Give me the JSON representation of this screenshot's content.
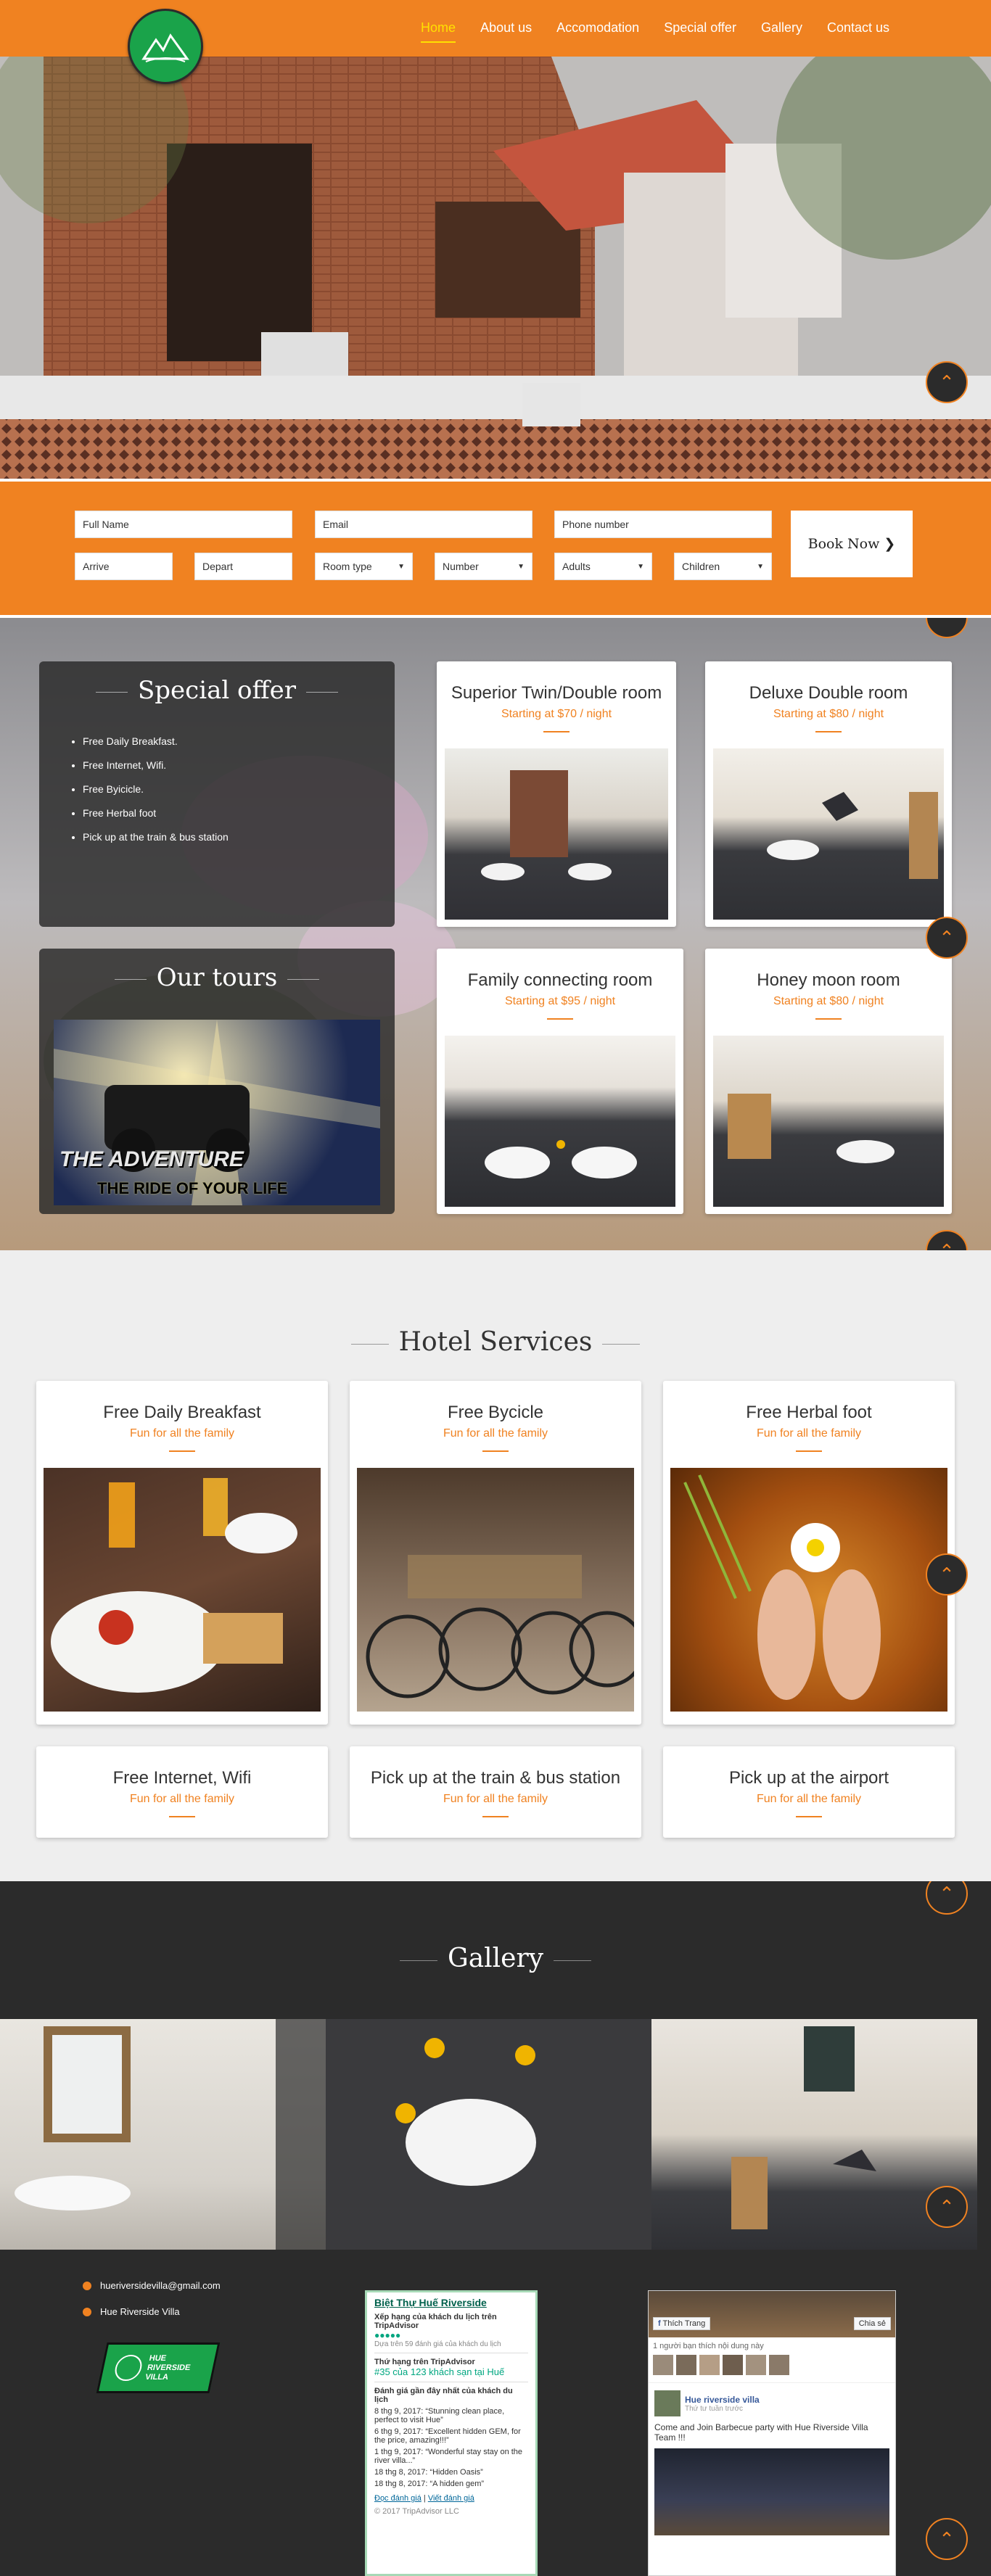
{
  "nav": {
    "logo_text": "Hue Riverside Villa",
    "items": [
      {
        "label": "Home",
        "active": true
      },
      {
        "label": "About us",
        "active": false
      },
      {
        "label": "Accomodation",
        "active": false
      },
      {
        "label": "Special offer",
        "active": false
      },
      {
        "label": "Gallery",
        "active": false
      },
      {
        "label": "Contact us",
        "active": false
      }
    ]
  },
  "booking": {
    "full_name_placeholder": "Full Name",
    "email_placeholder": "Email",
    "phone_placeholder": "Phone number",
    "arrive_placeholder": "Arrive",
    "depart_placeholder": "Depart",
    "room_type": "Room type",
    "number": "Number",
    "adults": "Adults",
    "children": "Children",
    "book_label": "Book Now"
  },
  "special_offer": {
    "title": "Special offer",
    "items": [
      "Free Daily Breakfast.",
      "Free Internet, Wifi.",
      "Free Byicicle.",
      "Free Herbal foot",
      "Pick up at the train & bus station"
    ]
  },
  "tours": {
    "title": "Our tours",
    "banner_line1": "THE ADVENTURE",
    "banner_line2": "THE RIDE OF YOUR LIFE"
  },
  "rooms": [
    {
      "name": "Superior Twin/Double room",
      "price": "Starting at $70 / night"
    },
    {
      "name": "Deluxe Double room",
      "price": "Starting at $80 / night"
    },
    {
      "name": "Family connecting room",
      "price": "Starting at $95 / night"
    },
    {
      "name": "Honey moon room",
      "price": "Starting at $80 / night"
    }
  ],
  "services": {
    "title": "Hotel Services",
    "items": [
      {
        "name": "Free Daily Breakfast",
        "sub": "Fun for all the family"
      },
      {
        "name": "Free Bycicle",
        "sub": "Fun for all the family"
      },
      {
        "name": "Free Herbal foot",
        "sub": "Fun for all the family"
      },
      {
        "name": "Free Internet, Wifi",
        "sub": "Fun for all the family"
      },
      {
        "name": "Pick up at the train & bus station",
        "sub": "Fun for all the family"
      },
      {
        "name": "Pick up at the airport",
        "sub": "Fun for all the family"
      }
    ]
  },
  "gallery": {
    "title": "Gallery"
  },
  "footer": {
    "email": "hueriversidevilla@gmail.com",
    "name": "Hue Riverside Villa",
    "badge_line1": "HUE",
    "badge_line2": "RIVERSIDE",
    "badge_line3": "VILLA"
  },
  "tripadvisor": {
    "title": "Biệt Thự Huế Riverside",
    "rank_heading": "Xếp hạng của khách du lịch trên TripAdvisor",
    "based_on": "Dựa trên 59 đánh giá của khách du lịch",
    "rank_label": "Thứ hạng trên TripAdvisor",
    "rank_value": "#35 của 123 khách sạn tại Huế",
    "recent_heading": "Đánh giá gần đây nhất của khách du lịch",
    "reviews": [
      "8 thg 9, 2017: “Stunning clean place, perfect to visit Hue”",
      "6 thg 9, 2017: “Excellent hidden GEM, for the price, amazing!!!”",
      "1 thg 9, 2017: “Wonderful stay stay on the river villa...”",
      "18 thg 8, 2017: “Hidden Oasis”",
      "18 thg 8, 2017: “A hidden gem”"
    ],
    "read_link": "Đọc đánh giá",
    "write_link": "Viết đánh giá",
    "copyright": "© 2017 TripAdvisor LLC"
  },
  "facebook": {
    "like_label": "Thích Trang",
    "share_label": "Chia sẻ",
    "likes_text": "1 người bạn thích nội dung này",
    "page_name": "Hue riverside villa",
    "page_time": "Thứ tư tuần trước",
    "post_text": "Come and Join Barbecue party with Hue Riverside Villa Team !!!"
  },
  "colors": {
    "accent": "#f08221",
    "dark": "#2b2b2b",
    "active_nav": "#ffe000"
  }
}
